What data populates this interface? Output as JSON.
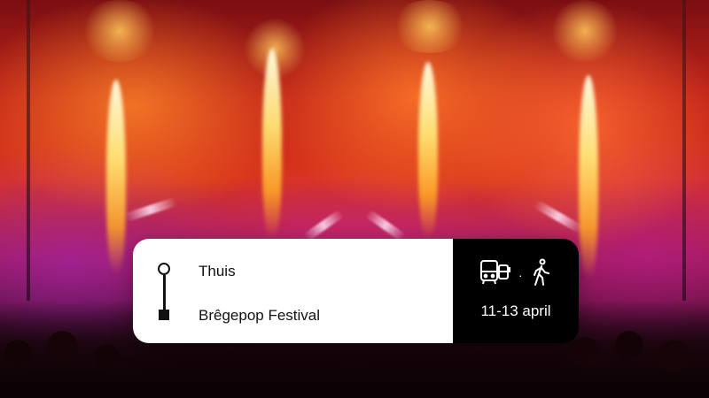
{
  "route": {
    "from": "Thuis",
    "to": "Brêgepop Festival"
  },
  "travel": {
    "modes": [
      "bus-train-icon",
      "walking-icon"
    ],
    "separator": "·",
    "dates": "11-13 april"
  },
  "colors": {
    "card_left": "#ffffff",
    "card_right": "#000000",
    "text_dark": "#111111",
    "text_light": "#ffffff"
  }
}
